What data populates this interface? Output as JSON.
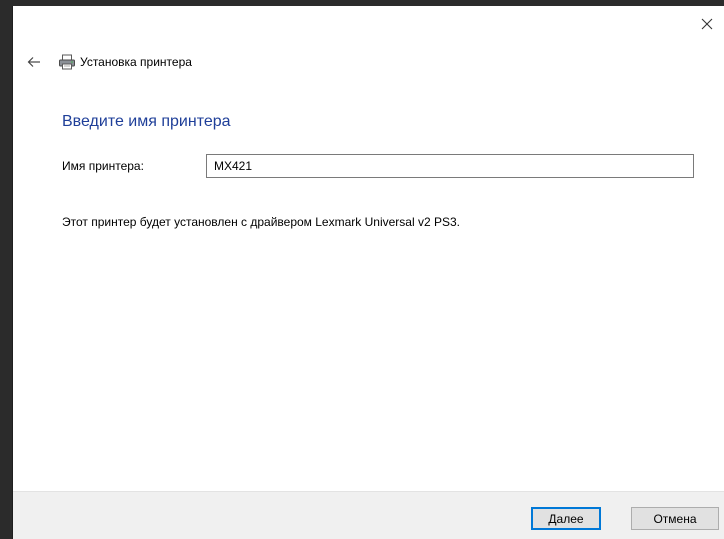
{
  "window": {
    "title": "Установка принтера"
  },
  "page": {
    "heading": "Введите имя принтера",
    "name_label": "Имя принтера:",
    "name_value": "MX421",
    "info": "Этот принтер будет установлен с драйвером Lexmark Universal v2 PS3."
  },
  "buttons": {
    "next_label": "Далее",
    "cancel_label": "Отмена"
  },
  "icons": {
    "close": "close-icon",
    "back": "back-arrow-icon",
    "printer": "printer-icon"
  },
  "colors": {
    "heading": "#1f3f99",
    "focus_border": "#0078d7",
    "footer": "#f0f0f0"
  }
}
